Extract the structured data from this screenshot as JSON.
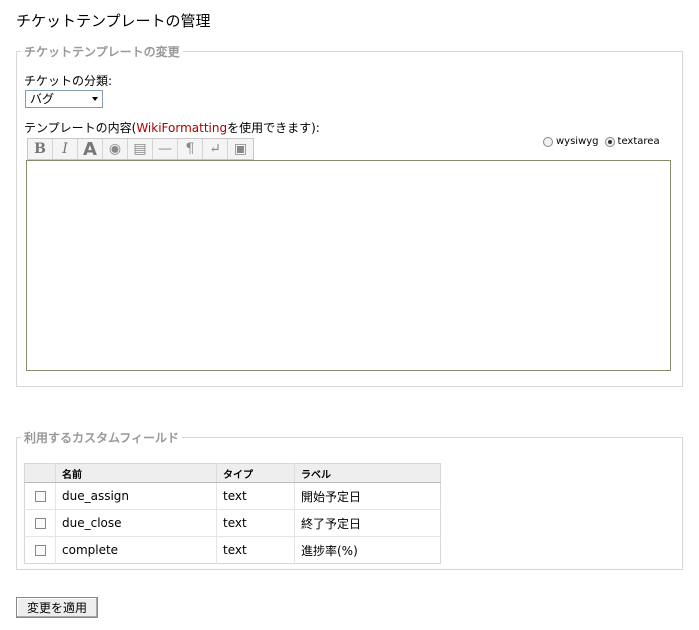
{
  "page": {
    "title": "チケットテンプレートの管理"
  },
  "template_section": {
    "legend": "チケットテンプレートの変更",
    "category_label": "チケットの分類:",
    "category_selected": "バグ",
    "content_label_prefix": "テンプレートの内容(",
    "content_label_link": "WikiFormatting",
    "content_label_suffix": "を使用できます):",
    "toolbar_buttons": [
      {
        "name": "bold-icon",
        "glyph": "B"
      },
      {
        "name": "italic-icon",
        "glyph": "I"
      },
      {
        "name": "heading-icon",
        "glyph": "A"
      },
      {
        "name": "link-icon",
        "glyph": "◉"
      },
      {
        "name": "code-block-icon",
        "glyph": "▤"
      },
      {
        "name": "horizontal-rule-icon",
        "glyph": "—"
      },
      {
        "name": "paragraph-icon",
        "glyph": "¶"
      },
      {
        "name": "line-break-icon",
        "glyph": "↵"
      },
      {
        "name": "image-icon",
        "glyph": "▣"
      }
    ],
    "editor_modes": {
      "wysiwyg": "wysiwyg",
      "textarea": "textarea",
      "selected": "textarea"
    },
    "textarea_value": ""
  },
  "fields_section": {
    "legend": "利用するカスタムフィールド",
    "headers": {
      "name": "名前",
      "type": "タイプ",
      "label": "ラベル"
    },
    "rows": [
      {
        "name": "due_assign",
        "type": "text",
        "label": "開始予定日",
        "checked": false
      },
      {
        "name": "due_close",
        "type": "text",
        "label": "終了予定日",
        "checked": false
      },
      {
        "name": "complete",
        "type": "text",
        "label": "進捗率(%)",
        "checked": false
      }
    ]
  },
  "actions": {
    "apply_label": "変更を適用"
  }
}
